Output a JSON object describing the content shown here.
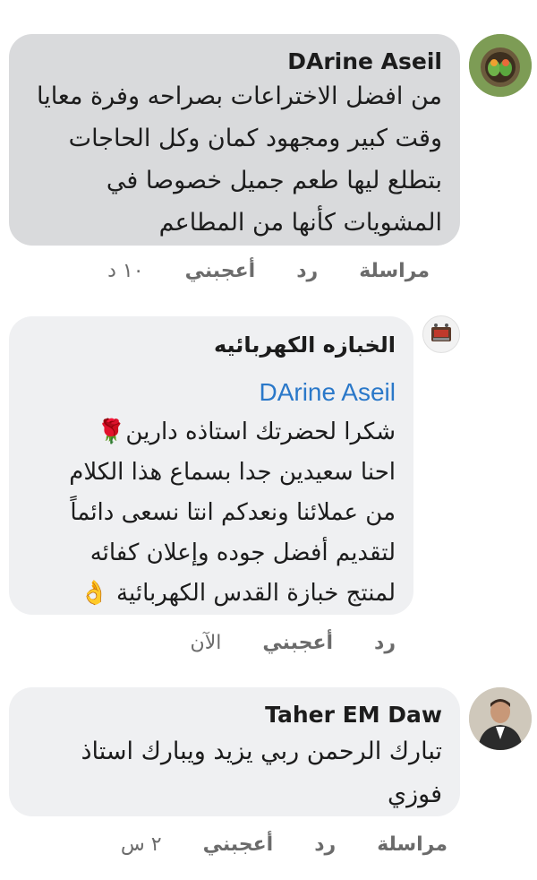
{
  "comments": [
    {
      "author": "DArine Aseil",
      "mention": "",
      "lines": [
        "من افضل الاختراعات بصراحه وفرة معايا",
        "وقت كبير ومجهود كمان وكل الحاجات",
        "بتطلع ليها طعم جميل خصوصا في",
        "المشويات كأنها من المطاعم"
      ],
      "time": "١٠ د",
      "like": "أعجبني",
      "reply": "رد",
      "message": "مراسلة"
    },
    {
      "author": "الخبازه الكهربائيه",
      "mention": "DArine Aseil",
      "lines": [
        "شكرا لحضرتك استاذه دارين🌹",
        "احنا سعيدين جدا بسماع هذا الكلام",
        "من عملائنا ونعدكم انتا نسعى دائماً",
        "لتقديم أفضل جوده وإعلان كفائه",
        "لمنتج خبازة القدس الكهربائية 👌"
      ],
      "time": "الآن",
      "like": "أعجبني",
      "reply": "رد",
      "message": ""
    },
    {
      "author": "Taher EM Daw",
      "mention": "",
      "lines": [
        "تبارك الرحمن ربي يزيد ويبارك استاذ",
        "فوزي"
      ],
      "time": "٢ س",
      "like": "أعجبني",
      "reply": "رد",
      "message": "مراسلة"
    }
  ],
  "colors": {
    "bubble_highlight": "#d9dadc",
    "bubble_normal": "#eff0f2",
    "mention": "#2a78c9",
    "action_text": "#6b6b6b"
  }
}
